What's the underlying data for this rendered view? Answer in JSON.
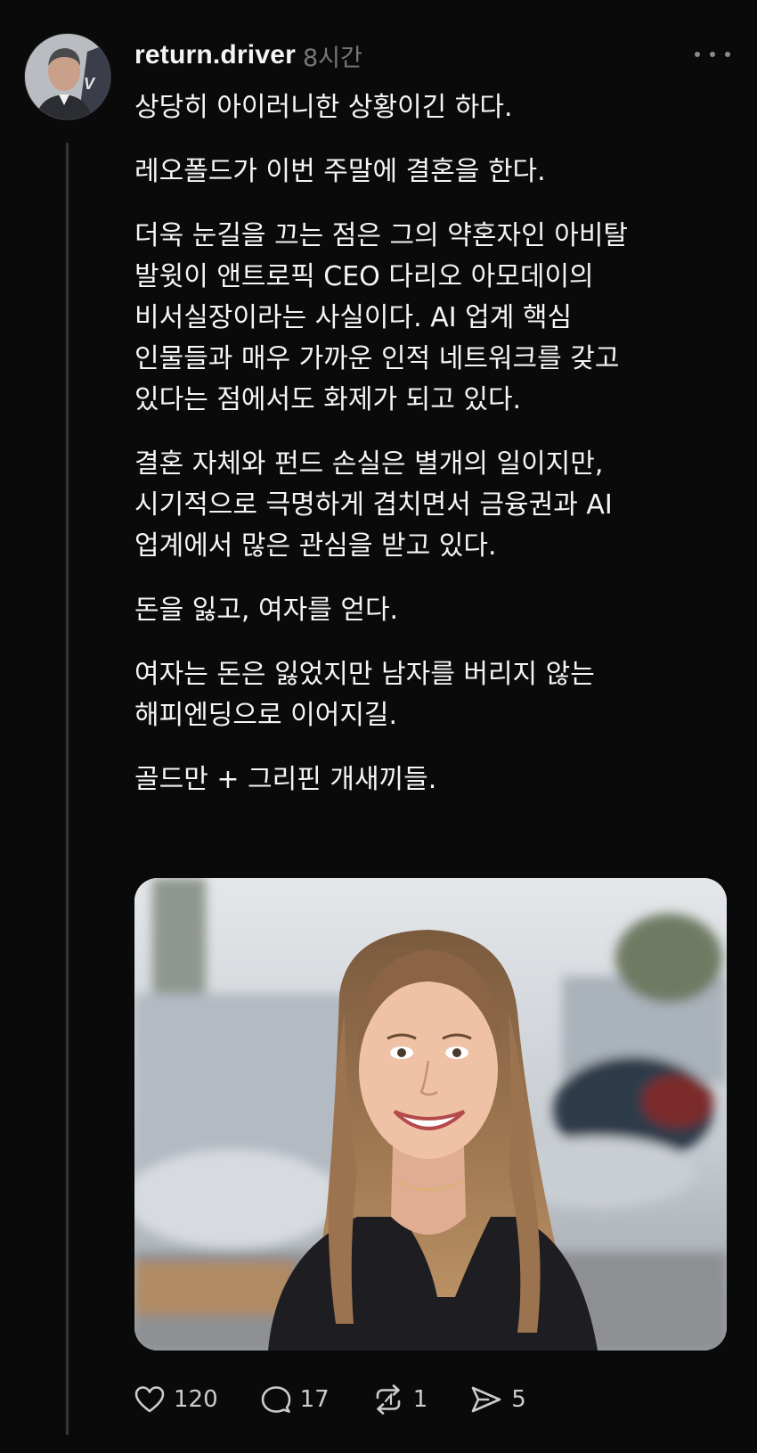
{
  "post": {
    "username": "return.driver",
    "time": "8시간",
    "paragraphs": [
      "상당히 아이러니한 상황이긴 하다.",
      "레오폴드가 이번 주말에 결혼을 한다.",
      "더욱 눈길을 끄는 점은 그의 약혼자인 아비탈\n발윗이 앤트로픽 CEO 다리오 아모데이의\n비서실장이라는 사실이다. AI 업계 핵심\n인물들과 매우 가까운 인적 네트워크를 갖고\n있다는 점에서도 화제가 되고 있다.",
      "결혼 자체와 펀드 손실은 별개의 일이지만,\n시기적으로 극명하게 겹치면서 금융권과 AI\n업계에서 많은 관심을 받고 있다.",
      "돈을 잃고, 여자를 얻다.",
      "여자는 돈은 잃었지만 남자를 버리지 않는\n해피엔딩으로 이어지길.",
      "골드만 + 그리핀 개새끼들."
    ]
  },
  "actions": {
    "likes": "120",
    "replies": "17",
    "reposts": "1",
    "shares": "5"
  },
  "icons": {
    "like": "heart-icon",
    "reply": "speech-bubble-icon",
    "repost": "repost-icon",
    "share": "send-icon",
    "more": "more-horizontal-icon"
  },
  "colors": {
    "background": "#0a0a0a",
    "text": "#f3f5f7",
    "muted": "#777777",
    "thread_line": "#333638"
  }
}
